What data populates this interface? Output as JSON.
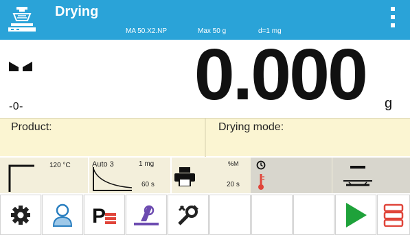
{
  "header": {
    "title": "Drying",
    "model": "MA 50.X2.NP",
    "max": "Max 50 g",
    "division": "d=1 mg",
    "logo_icon": "balance-logo-icon",
    "menu_icon": "kebab-menu-icon",
    "color": "#2aa3d8"
  },
  "display": {
    "value": "0.000",
    "unit": "g",
    "stability_icon": "stability-indicator-icon",
    "zero_icon_text": "-0-"
  },
  "info": {
    "product_label": "Product:",
    "drying_mode_label": "Drying mode:"
  },
  "params": {
    "temperature": "120 °C",
    "auto_mode": "Auto 3",
    "auto_mass": "1 mg",
    "auto_time": "60 s",
    "print_unit": "%M",
    "print_interval": "20 s"
  },
  "toolbar": {
    "buttons": [
      {
        "icon": "settings-gear-icon"
      },
      {
        "icon": "user-icon"
      },
      {
        "icon": "product-database-icon"
      },
      {
        "icon": "calibration-icon"
      },
      {
        "icon": "tools-icon"
      },
      {
        "icon": "empty"
      },
      {
        "icon": "empty"
      },
      {
        "icon": "empty"
      },
      {
        "icon": "start-play-icon"
      },
      {
        "icon": "database-records-icon"
      }
    ]
  },
  "colors": {
    "header_bg": "#2aa3d8",
    "info_bg": "#fbf5d2",
    "play_green": "#1ea23a",
    "accent_red": "#e0453a"
  }
}
